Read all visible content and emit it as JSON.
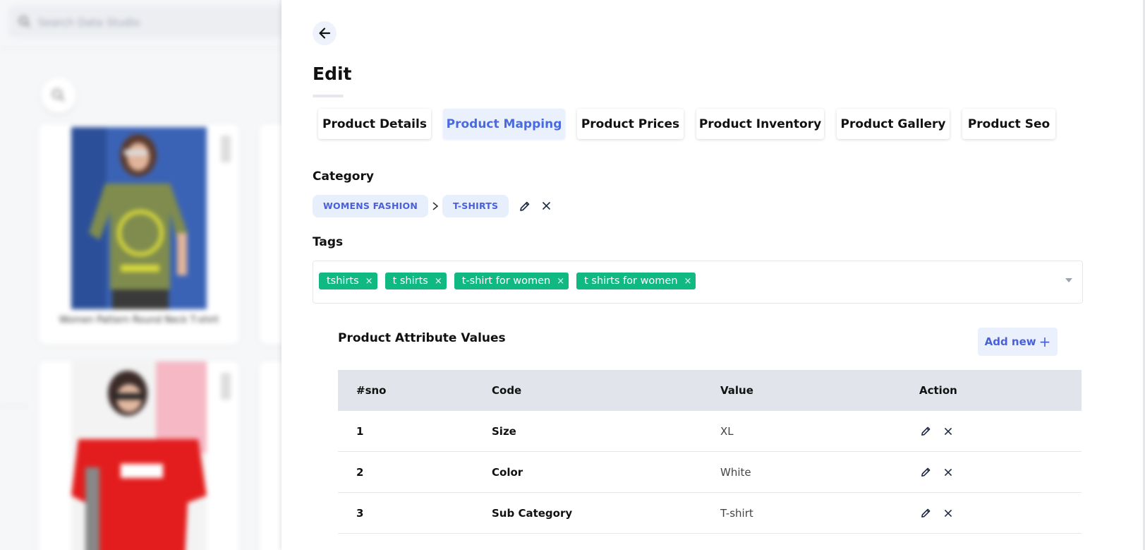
{
  "background": {
    "search_placeholder": "Search Data Studio",
    "card_caption": "Women Pattern Round Neck T-shirt"
  },
  "panel": {
    "title": "Edit",
    "tabs": [
      {
        "label": "Product Details",
        "active": false
      },
      {
        "label": "Product Mapping",
        "active": true
      },
      {
        "label": "Product Prices",
        "active": false
      },
      {
        "label": "Product Inventory",
        "active": false
      },
      {
        "label": "Product Gallery",
        "active": false
      },
      {
        "label": "Product Seo",
        "active": false
      }
    ],
    "category": {
      "label": "Category",
      "path": [
        "WOMENS FASHION",
        "T-SHIRTS"
      ]
    },
    "tags": {
      "label": "Tags",
      "items": [
        "tshirts",
        "t shirts",
        "t-shirt for women",
        "t shirts for women"
      ]
    },
    "attributes": {
      "title": "Product Attribute Values",
      "add_label": "Add new",
      "columns": [
        "#sno",
        "Code",
        "Value",
        "Action"
      ],
      "rows": [
        {
          "sno": "1",
          "code": "Size",
          "value": "XL"
        },
        {
          "sno": "2",
          "code": "Color",
          "value": "White"
        },
        {
          "sno": "3",
          "code": "Sub Category",
          "value": "T-shirt"
        }
      ]
    }
  },
  "colors": {
    "accent": "#4a60d8",
    "tag_green": "#10b981",
    "active_tab_bg": "#eaf1fd",
    "table_header_bg": "#e1e4ea"
  }
}
